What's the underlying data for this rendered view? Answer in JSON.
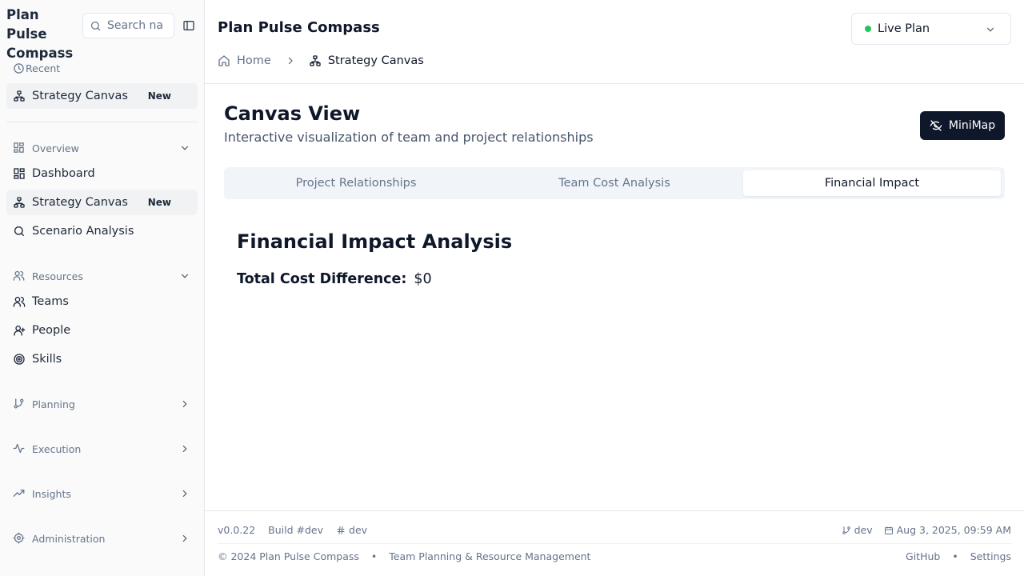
{
  "sidebar": {
    "brand": "Plan Pulse Compass",
    "search_placeholder": "Search na",
    "recent_label": "Recent",
    "recent_items": [
      {
        "label": "Strategy Canvas",
        "badge": "New"
      }
    ],
    "groups": {
      "overview": "Overview",
      "resources": "Resources",
      "planning": "Planning",
      "execution": "Execution",
      "insights": "Insights",
      "administration": "Administration"
    },
    "overview_items": [
      {
        "label": "Dashboard",
        "icon": "layout-dashboard-icon"
      },
      {
        "label": "Strategy Canvas",
        "icon": "network-icon",
        "badge": "New"
      },
      {
        "label": "Scenario Analysis",
        "icon": "search-icon"
      }
    ],
    "resource_items": [
      {
        "label": "Teams",
        "icon": "users-icon"
      },
      {
        "label": "People",
        "icon": "user-icon"
      },
      {
        "label": "Skills",
        "icon": "target-icon"
      }
    ]
  },
  "header": {
    "title": "Plan Pulse Compass",
    "plan_select": {
      "value": "Live Plan",
      "status_color": "#22c55e"
    },
    "breadcrumb": {
      "home": "Home",
      "current": "Strategy Canvas"
    }
  },
  "main": {
    "title": "Canvas View",
    "subtitle": "Interactive visualization of team and project relationships",
    "minimap_label": "MiniMap",
    "tabs": [
      {
        "label": "Project Relationships"
      },
      {
        "label": "Team Cost Analysis"
      },
      {
        "label": "Financial Impact",
        "active": true
      }
    ],
    "section_title": "Financial Impact Analysis",
    "cost_label": "Total Cost Difference:",
    "cost_value": "$0"
  },
  "footer": {
    "version": "v0.0.22",
    "build": "Build #dev",
    "hash": "dev",
    "branch": "dev",
    "date": "Aug 3, 2025, 09:59 AM",
    "copyright": "© 2024 Plan Pulse Compass",
    "tagline": "Team Planning & Resource Management",
    "github": "GitHub",
    "settings": "Settings"
  },
  "colors": {
    "accent_dark": "#0f172a",
    "muted": "#64748b",
    "status_live": "#22c55e"
  }
}
